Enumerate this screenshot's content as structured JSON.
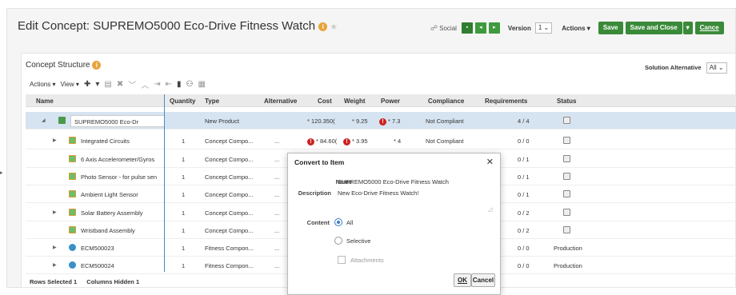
{
  "header": {
    "title": "Edit Concept: SUPREMO5000 Eco-Drive Fitness Watch",
    "social_label": "Social",
    "version_label": "Version",
    "version_value": "1",
    "actions_label": "Actions",
    "save_label": "Save",
    "save_close_label": "Save and Close",
    "cancel_label": "Cance"
  },
  "structure": {
    "title": "Concept Structure",
    "solution_alt_label": "Solution Alternative",
    "solution_alt_value": "All",
    "toolbar": {
      "actions": "Actions",
      "view": "View"
    }
  },
  "columns": {
    "name": "Name",
    "quantity": "Quantity",
    "type": "Type",
    "alternative": "Alternative",
    "cost": "Cost",
    "weight": "Weight",
    "power": "Power",
    "compliance": "Compliance",
    "requirements": "Requirements",
    "status": "Status"
  },
  "rows": [
    {
      "name": "SUPREMO5000 Eco-Dr",
      "quantity": "",
      "type": "New Product",
      "alternative": "",
      "cost": "* 120.350(",
      "weight": "* 9.25",
      "power": "* 7.3",
      "compliance": "Not Compliant",
      "requirements": "4 / 4",
      "status": ""
    },
    {
      "name": "Integrated Circuits",
      "quantity": "1",
      "type": "Concept Compo...",
      "alternative": "...",
      "cost": "* 84.60(",
      "weight": "* 3.95",
      "power": "* 4",
      "compliance": "Not Compliant",
      "requirements": "0 / 0",
      "status": ""
    },
    {
      "name": "6 Axis Accelerometer/Gyros",
      "quantity": "1",
      "type": "Concept Compo...",
      "alternative": "...",
      "cost": "",
      "weight": "",
      "power": "",
      "compliance": "",
      "requirements": "0 / 1",
      "status": ""
    },
    {
      "name": "Photo Sensor - for pulse sen",
      "quantity": "1",
      "type": "Concept Compo...",
      "alternative": "...",
      "cost": "",
      "weight": "",
      "power": "",
      "compliance": "",
      "requirements": "0 / 1",
      "status": ""
    },
    {
      "name": "Ambient Light Sensor",
      "quantity": "1",
      "type": "Concept Compo...",
      "alternative": "...",
      "cost": "",
      "weight": "",
      "power": "",
      "compliance": "",
      "requirements": "0 / 1",
      "status": ""
    },
    {
      "name": "Solar Battery Assembly",
      "quantity": "1",
      "type": "Concept Compo...",
      "alternative": "...",
      "cost": "",
      "weight": "",
      "power": "",
      "compliance": "",
      "requirements": "0 / 2",
      "status": ""
    },
    {
      "name": "Wristband Assembly",
      "quantity": "1",
      "type": "Concept Compo...",
      "alternative": "...",
      "cost": "",
      "weight": "",
      "power": "",
      "compliance": "",
      "requirements": "0 / 2",
      "status": ""
    },
    {
      "name": "ECM500023",
      "quantity": "1",
      "type": "Fitness Compon...",
      "alternative": "...",
      "cost": "",
      "weight": "",
      "power": "",
      "compliance": "",
      "requirements": "0 / 0",
      "status": "Production"
    },
    {
      "name": "ECM500024",
      "quantity": "1",
      "type": "Fitness Compon...",
      "alternative": "...",
      "cost": "",
      "weight": "",
      "power": "",
      "compliance": "",
      "requirements": "0 / 0",
      "status": "Production"
    }
  ],
  "footer": {
    "rows_selected": "Rows Selected  1",
    "columns_hidden": "Columns Hidden  1"
  },
  "dialog": {
    "title": "Convert to Item",
    "name_label": "Name",
    "name_value": "SUPREMO5000 Eco-Drive Fitness Watch",
    "description_label": "Description",
    "description_value": "New Eco-Drive Fitness Watch!",
    "content_label": "Content",
    "option_all": "All",
    "option_selective": "Selective",
    "attachments_label": "Attachments",
    "ok_label": "OK",
    "cancel_label": "Cancel",
    "selected_option": "All"
  },
  "colors": {
    "accent_green": "#3a8a3a",
    "selected_row": "#d6e3f0",
    "error_red": "#cc2222",
    "info_orange": "#e8a33d"
  }
}
